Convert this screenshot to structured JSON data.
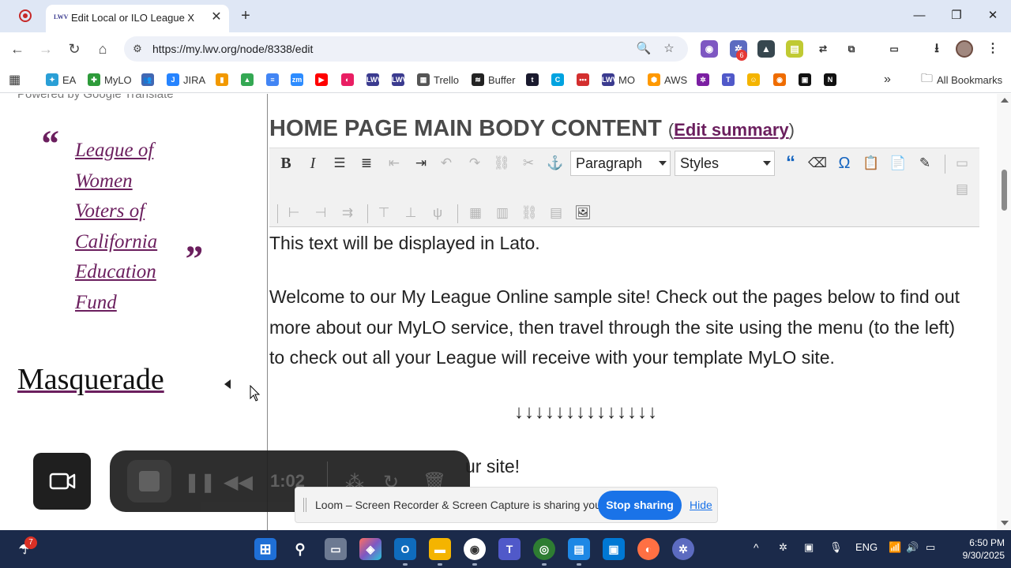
{
  "browser": {
    "tab_title": "Edit Local or ILO League X",
    "tab_favicon": "LWV",
    "url": "https://my.lwv.org/node/8338/edit",
    "bookmarks": [
      {
        "label": "EA",
        "color": "#2a9fd6",
        "glyph": "✦"
      },
      {
        "label": "MyLO",
        "color": "#2e9b3a",
        "glyph": "✚"
      },
      {
        "label": "",
        "color": "#4267b2",
        "glyph": "👥"
      },
      {
        "label": "JIRA",
        "color": "#2684ff",
        "glyph": "J"
      },
      {
        "label": "",
        "color": "#f29900",
        "glyph": "▮"
      },
      {
        "label": "",
        "color": "#34a853",
        "glyph": "▲"
      },
      {
        "label": "",
        "color": "#4285f4",
        "glyph": "≡"
      },
      {
        "label": "",
        "color": "#2d8cff",
        "glyph": "zm"
      },
      {
        "label": "",
        "color": "#ff0000",
        "glyph": "▶"
      },
      {
        "label": "",
        "color": "#e91e63",
        "glyph": "◐"
      },
      {
        "label": "",
        "color": "#3b3b8f",
        "glyph": "LWV"
      },
      {
        "label": "",
        "color": "#3b3b8f",
        "glyph": "LWV"
      },
      {
        "label": "Trello",
        "color": "#555555",
        "glyph": "▦"
      },
      {
        "label": "Buffer",
        "color": "#222222",
        "glyph": "≋"
      },
      {
        "label": "",
        "color": "#1a1a2e",
        "glyph": "t"
      },
      {
        "label": "",
        "color": "#00a3e0",
        "glyph": "C"
      },
      {
        "label": "",
        "color": "#d32f2f",
        "glyph": "•••"
      },
      {
        "label": "MO",
        "color": "#3b3b8f",
        "glyph": "LWV"
      },
      {
        "label": "AWS",
        "color": "#ff9900",
        "glyph": "⬢"
      },
      {
        "label": "",
        "color": "#7b1fa2",
        "glyph": "✲"
      },
      {
        "label": "",
        "color": "#5059c9",
        "glyph": "T"
      },
      {
        "label": "",
        "color": "#f4b400",
        "glyph": "☺"
      },
      {
        "label": "",
        "color": "#ef6c00",
        "glyph": "◉"
      },
      {
        "label": "",
        "color": "#111111",
        "glyph": "▣"
      },
      {
        "label": "",
        "color": "#111111",
        "glyph": "N"
      }
    ],
    "all_bookmarks_label": "All Bookmarks",
    "ext_badge": "6"
  },
  "sidebar": {
    "powered_by": "Powered by Google Translate",
    "quote_open": "“",
    "quote_close": "”",
    "quote_link": "League of Women Voters of California Education Fund",
    "masquerade": "Masquerade"
  },
  "editor": {
    "heading": "HOME PAGE MAIN BODY CONTENT",
    "edit_summary": "Edit summary",
    "format_select": "Paragraph",
    "styles_select": "Styles",
    "para1": "This text will be displayed in Lato.",
    "para2": "Welcome to our My League Online sample site! Check out the pages below to find out more about our MyLO service, then travel through the site using the menu (to the left) to check out all your League will receive with your template MyLO site.",
    "arrows": "↓↓↓↓↓↓↓↓↓↓↓↓↓↓",
    "para3": "ur site!"
  },
  "loom": {
    "timer": "1:02",
    "share_text": "Loom – Screen Recorder & Screen Capture is sharing your screen.",
    "stop_sharing": "Stop sharing",
    "hide": "Hide"
  },
  "taskbar": {
    "weather_badge": "7",
    "lang": "ENG",
    "time": "6:50 PM",
    "date": "9/30/2025"
  }
}
